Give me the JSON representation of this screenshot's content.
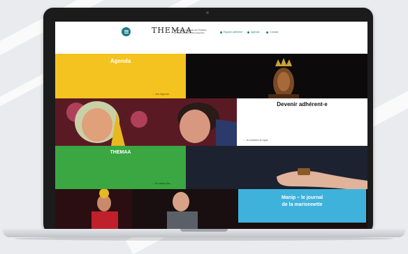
{
  "header": {
    "logo_text": "THEMAA",
    "tagline": "Association nationale des Théâtres de Marionnettes et Arts Associés",
    "nav": [
      {
        "label": "Espace adhérent",
        "icon": "user-icon"
      },
      {
        "label": "Agenda",
        "icon": "calendar-icon"
      },
      {
        "label": "Contact",
        "icon": "mail-icon"
      }
    ]
  },
  "tiles": {
    "agenda": {
      "title": "Agenda",
      "link": "Voir l'agenda",
      "color": "#f4c31f"
    },
    "adherent": {
      "title": "Devenir adhérent·e",
      "link": "Je m'adhère en ligne",
      "color": "#ffffff"
    },
    "themaa": {
      "title": "THEMAA",
      "link": "En savoir plus",
      "color": "#3aa742"
    },
    "manip": {
      "title_line1": "Manip – le journal",
      "title_line2": "de la marionnette",
      "color": "#3fb2dc"
    }
  },
  "colors": {
    "accent": "#1a7a86",
    "dark_tile": "#1d2230"
  }
}
